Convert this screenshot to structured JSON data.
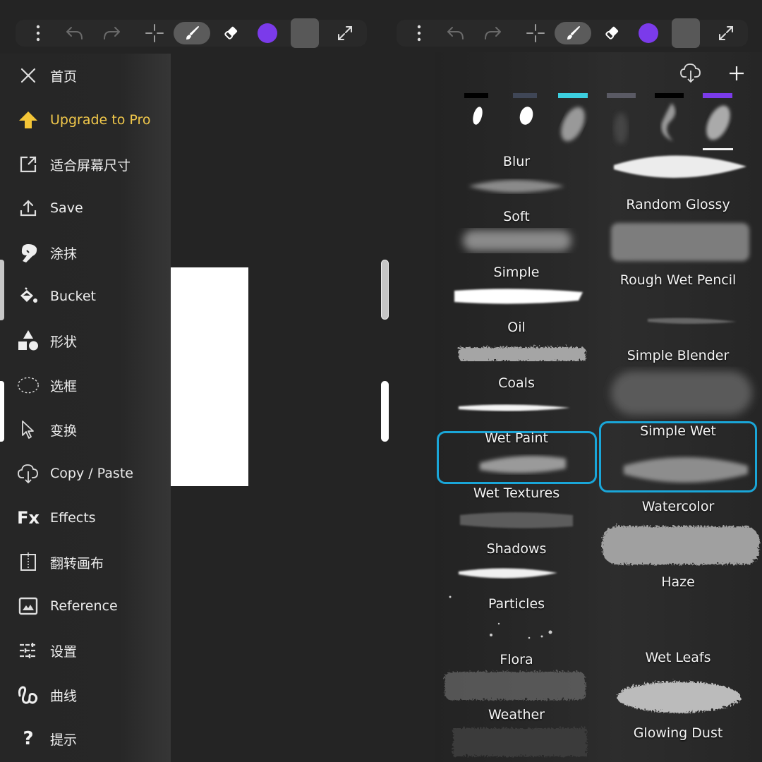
{
  "toolbars": [
    {
      "id": "left",
      "buttons": [
        {
          "name": "more-menu",
          "icon": "vertical-ellipsis-icon"
        },
        {
          "name": "undo",
          "icon": "undo-icon"
        },
        {
          "name": "redo",
          "icon": "redo-icon"
        },
        {
          "name": "move",
          "icon": "crosshair-icon"
        },
        {
          "name": "brush",
          "icon": "paintbrush-icon",
          "active": true
        },
        {
          "name": "eraser",
          "icon": "eraser-icon"
        },
        {
          "name": "color",
          "icon": "color-swatch-icon"
        },
        {
          "name": "layers",
          "icon": "layers-square-icon"
        },
        {
          "name": "fullscreen",
          "icon": "expand-icon"
        }
      ],
      "current_color": "#7b3bea"
    },
    {
      "id": "right",
      "buttons": [
        {
          "name": "more-menu",
          "icon": "vertical-ellipsis-icon"
        },
        {
          "name": "undo",
          "icon": "undo-icon"
        },
        {
          "name": "redo",
          "icon": "redo-icon"
        },
        {
          "name": "move",
          "icon": "crosshair-icon"
        },
        {
          "name": "brush",
          "icon": "paintbrush-icon",
          "active": true
        },
        {
          "name": "eraser",
          "icon": "eraser-icon"
        },
        {
          "name": "color",
          "icon": "color-swatch-icon"
        },
        {
          "name": "layers",
          "icon": "layers-square-icon"
        },
        {
          "name": "fullscreen",
          "icon": "expand-icon"
        }
      ],
      "current_color": "#7b3bea"
    }
  ],
  "menu": {
    "items": [
      {
        "label": "首页",
        "icon": "close-icon"
      },
      {
        "label": "Upgrade to Pro",
        "icon": "arrow-up-icon",
        "highlight": true
      },
      {
        "label": "适合屏幕尺寸",
        "icon": "fit-screen-icon"
      },
      {
        "label": "Save",
        "icon": "upload-icon"
      },
      {
        "label": "涂抹",
        "icon": "smudge-finger-icon"
      },
      {
        "label": "Bucket",
        "icon": "paint-bucket-icon"
      },
      {
        "label": "形状",
        "icon": "shapes-icon"
      },
      {
        "label": "选框",
        "icon": "lasso-ellipse-icon"
      },
      {
        "label": "变换",
        "icon": "cursor-arrow-icon"
      },
      {
        "label": "Copy / Paste",
        "icon": "cloud-download-icon"
      },
      {
        "label": "Effects",
        "icon": "fx-icon",
        "icon_text": "Fx"
      },
      {
        "label": "翻转画布",
        "icon": "flip-canvas-icon"
      },
      {
        "label": "Reference",
        "icon": "image-icon"
      },
      {
        "label": "设置",
        "icon": "sliders-icon"
      },
      {
        "label": "曲线",
        "icon": "curve-icon"
      },
      {
        "label": "提示",
        "icon": "help-icon",
        "icon_text": "?"
      }
    ],
    "accent_color": "#f1c84b"
  },
  "brush_panel": {
    "header_buttons": [
      {
        "name": "import-brush",
        "icon": "cloud-download-icon"
      },
      {
        "name": "add-brush",
        "icon": "plus-icon"
      }
    ],
    "category_tabs": [
      {
        "color": "#000000"
      },
      {
        "color": "#3f4656"
      },
      {
        "color": "#3ccfdf"
      },
      {
        "color": "#5a5a64"
      },
      {
        "color": "#000000"
      },
      {
        "color": "#7b3bea",
        "selected": true
      }
    ],
    "left_column": [
      {
        "label": "Blur"
      },
      {
        "label": "Soft"
      },
      {
        "label": "Simple"
      },
      {
        "label": "Oil"
      },
      {
        "label": "Coals"
      },
      {
        "label": "Wet Paint",
        "selected": true
      },
      {
        "label": "Wet Textures"
      },
      {
        "label": "Shadows"
      },
      {
        "label": "Particles"
      },
      {
        "label": "Flora"
      },
      {
        "label": "Weather"
      }
    ],
    "right_column": [
      {
        "label": "Random Glossy"
      },
      {
        "label": "Rough Wet Pencil"
      },
      {
        "label": "Simple Blender"
      },
      {
        "label": "Simple Wet",
        "selected": true
      },
      {
        "label": "Watercolor"
      },
      {
        "label": "Haze"
      },
      {
        "label": "Wet Leafs"
      },
      {
        "label": "Glowing Dust"
      }
    ],
    "selection_color": "#1aa6d8"
  }
}
